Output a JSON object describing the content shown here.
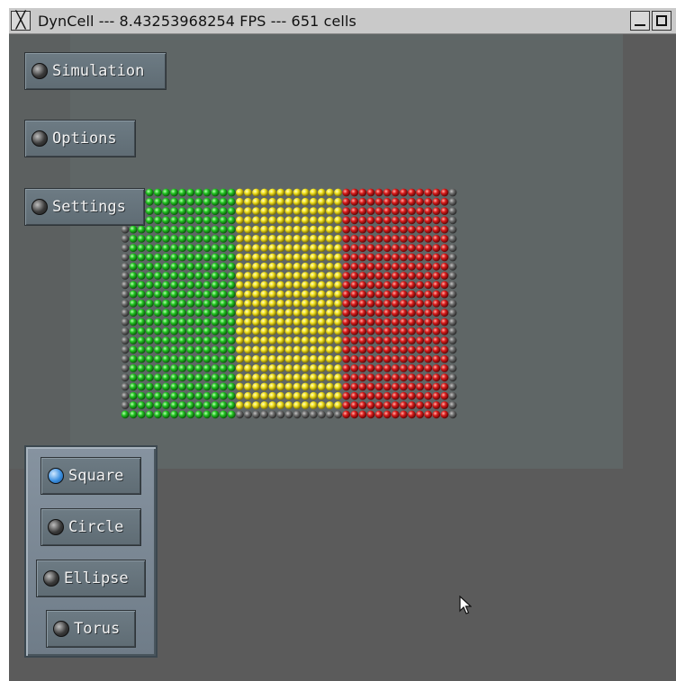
{
  "window": {
    "title": "DynCell --- 8.43253968254 FPS --- 651 cells",
    "close_glyph": "╳"
  },
  "menu": {
    "simulation_label": "Simulation",
    "options_label": "Options",
    "settings_label": "Settings"
  },
  "shape_options": [
    {
      "label": "Square",
      "selected": true
    },
    {
      "label": "Circle",
      "selected": false
    },
    {
      "label": "Ellipse",
      "selected": false
    },
    {
      "label": "Torus",
      "selected": false
    }
  ],
  "cell_grid": {
    "rows": 25,
    "columns": 41,
    "color_bands": [
      {
        "color": "green",
        "hex": "#22c422"
      },
      {
        "color": "yellow",
        "hex": "#f2e21e"
      },
      {
        "color": "red",
        "hex": "#d91b1b"
      },
      {
        "color": "grey",
        "hex": "#6e6e6e"
      }
    ]
  },
  "colors": {
    "titlebar": "#c9c9c9",
    "background": "#5b5b5b",
    "viewport": "#5f6666",
    "button_face": "#66737c",
    "led_selected": "#3a8fe0"
  }
}
